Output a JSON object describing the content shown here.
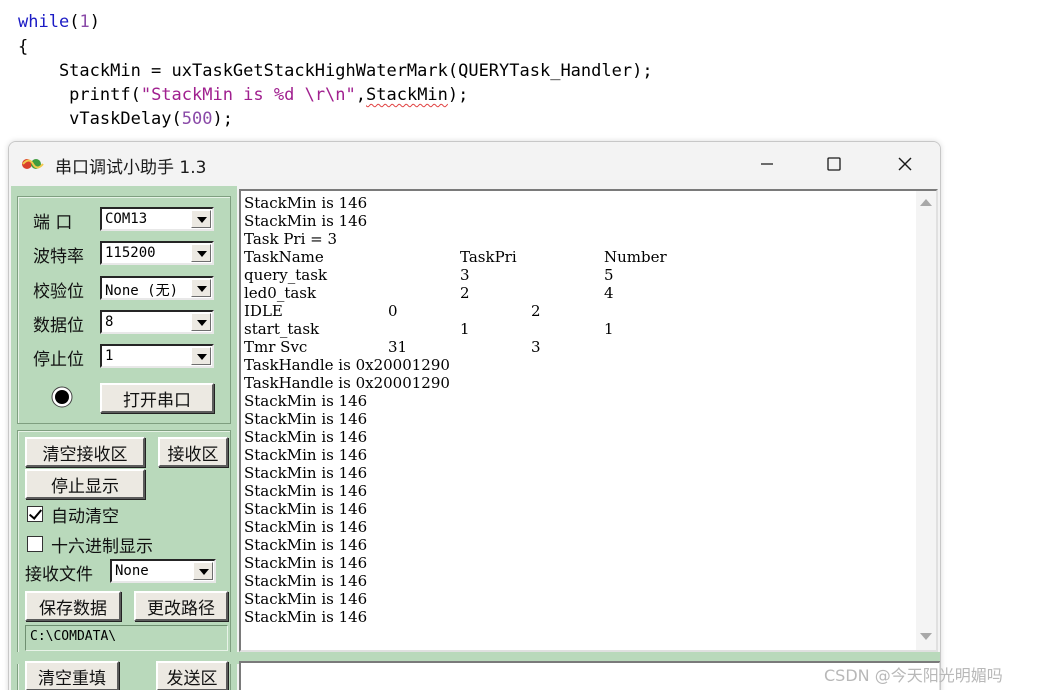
{
  "code": {
    "line1_kw": "while",
    "line1_rest_a": "(",
    "line1_num": "1",
    "line1_rest_b": ")",
    "line2": "{",
    "line3": "    StackMin = uxTaskGetStackHighWaterMark(QUERYTask_Handler);",
    "line4_a": "     printf(",
    "line4_str": "\"StackMin is %d \\r\\n\"",
    "line4_b": ",",
    "line4_sq": "StackMin",
    "line4_c": ");",
    "line5_a": "     vTaskDelay(",
    "line5_num": "500",
    "line5_b": ");"
  },
  "window": {
    "title": "串口调试小助手 1.3",
    "minimize_glyph": "—",
    "maximize_glyph": "☐",
    "close_glyph": "✕"
  },
  "settings": {
    "port_label": "端  口",
    "port_value": "COM13",
    "baud_label": "波特率",
    "baud_value": "115200",
    "parity_label": "校验位",
    "parity_value": "None (无)",
    "databits_label": "数据位",
    "databits_value": "8",
    "stopbits_label": "停止位",
    "stopbits_value": "1",
    "open_port_button": "打开串口"
  },
  "receive_controls": {
    "clear_recv_button": "清空接收区",
    "recv_area_button": "接收区",
    "stop_display_button": "停止显示",
    "auto_clear_label": "自动清空",
    "auto_clear_checked": true,
    "hex_display_label": "十六进制显示",
    "hex_display_checked": false,
    "recv_file_label": "接收文件",
    "recv_file_value": "None",
    "save_data_button": "保存数据",
    "change_path_button": "更改路径",
    "path_value": "C:\\COMDATA\\"
  },
  "send_controls": {
    "clear_refill_button": "清空重填",
    "send_area_button": "发送区"
  },
  "receive_lines": [
    [
      "StackMin is 146"
    ],
    [
      "StackMin is 146"
    ],
    [
      "Task Pri = 3"
    ],
    [
      "TaskName",
      "TaskPri",
      "Number"
    ],
    [
      "query_task",
      "3",
      "5"
    ],
    [
      "led0_task",
      "2",
      "4"
    ],
    [
      "IDLE",
      "0",
      "2"
    ],
    [
      "start_task",
      "1",
      "1"
    ],
    [
      "Tmr Svc",
      "31",
      "3"
    ],
    [
      "TaskHandle is 0x20001290"
    ],
    [
      "TaskHandle is 0x20001290"
    ],
    [
      "StackMin is 146"
    ],
    [
      "StackMin is 146"
    ],
    [
      "StackMin is 146"
    ],
    [
      "StackMin is 146"
    ],
    [
      "StackMin is 146"
    ],
    [
      "StackMin is 146"
    ],
    [
      "StackMin is 146"
    ],
    [
      "StackMin is 146"
    ],
    [
      "StackMin is 146"
    ],
    [
      "StackMin is 146"
    ],
    [
      "StackMin is 146"
    ],
    [
      "StackMin is 146"
    ],
    [
      "StackMin is 146"
    ]
  ],
  "watermark": "CSDN @今天阳光明媚吗",
  "colors": {
    "panel_green": "#b9d9bb",
    "keyword_blue": "#1b1bc5",
    "string_purple": "#a0208f"
  }
}
